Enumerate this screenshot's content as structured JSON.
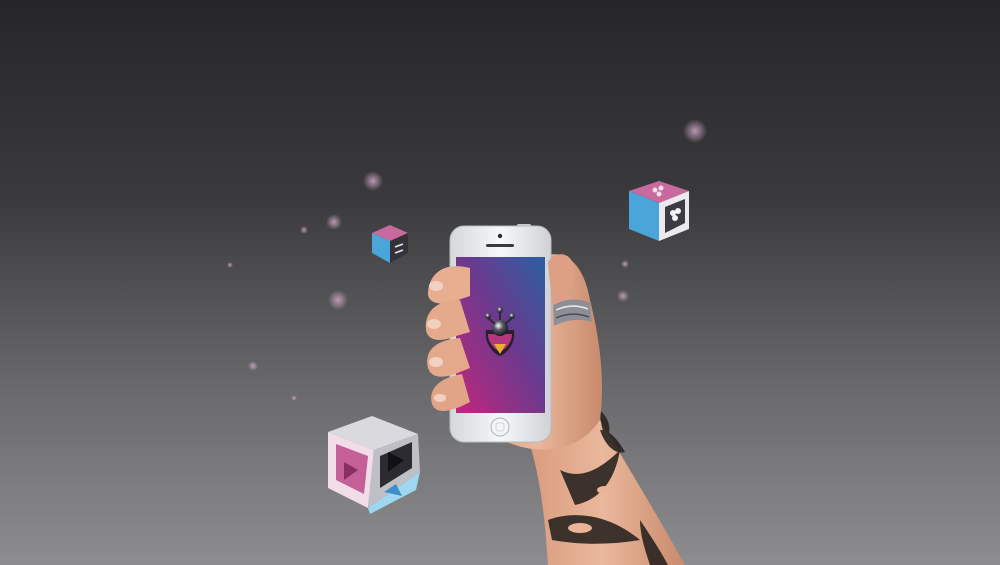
{
  "scene": {
    "description_key": "phone-in-hand-promo",
    "colors": {
      "bg_top": "#262628",
      "bg_bottom": "#8d8d90",
      "screen_magenta": "#c2267c",
      "screen_blue": "#2c5fa0",
      "skin": "#e9b498",
      "skin_shadow": "#c98a6c",
      "tattoo": "#2a2420",
      "phone_body": "#eceef0",
      "cube_pink": "#c86a9e",
      "cube_blue": "#4aa6d8",
      "cube_dark": "#35333a"
    },
    "icons": [
      "app-logo-icon",
      "play-icon",
      "clover-icon",
      "shuffle-icon"
    ]
  }
}
